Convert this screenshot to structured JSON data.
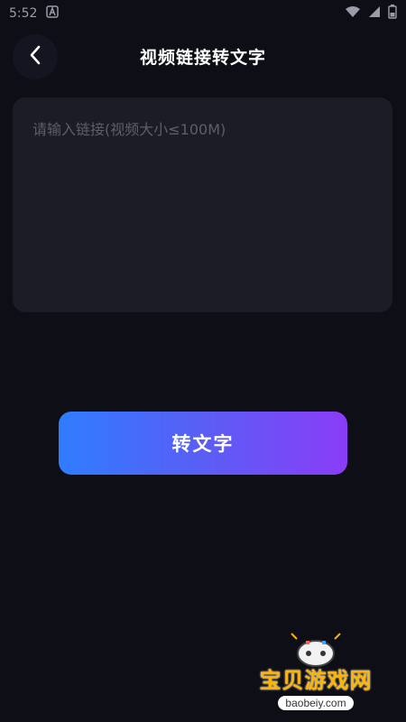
{
  "status_bar": {
    "time": "5:52"
  },
  "nav": {
    "title": "视频链接转文字"
  },
  "input": {
    "placeholder": "请输入链接(视频大小≤100M)",
    "value": ""
  },
  "actions": {
    "convert_label": "转文字"
  },
  "watermark": {
    "name": "宝贝游戏网",
    "domain": "baobeiy.com"
  },
  "colors": {
    "background": "#0d0e16",
    "input_background": "#1b1c26",
    "button_gradient_start": "#2f7cff",
    "button_gradient_end": "#8a3cf7"
  },
  "icons": {
    "back": "chevron-left-icon",
    "status_notification": "a-icon",
    "wifi": "wifi-icon",
    "battery": "battery-icon"
  }
}
